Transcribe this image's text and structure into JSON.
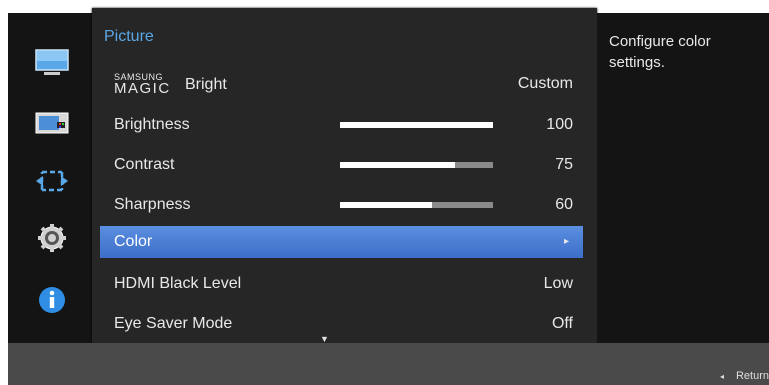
{
  "sidebar": {
    "icons": [
      "picture-icon",
      "onscreen-display-icon",
      "system-icon",
      "settings-icon",
      "information-icon"
    ]
  },
  "menu": {
    "title": "Picture",
    "magic_bright": {
      "brand_small": "SAMSUNG",
      "brand_large": "MAGIC",
      "label": "Bright",
      "value": "Custom"
    },
    "brightness": {
      "label": "Brightness",
      "value": "100",
      "level": 1.0
    },
    "contrast": {
      "label": "Contrast",
      "value": "75",
      "level": 0.75
    },
    "sharpness": {
      "label": "Sharpness",
      "value": "60",
      "level": 0.6
    },
    "color": {
      "label": "Color",
      "arrow": "▸"
    },
    "hdmi_black_level": {
      "label": "HDMI Black Level",
      "value": "Low"
    },
    "eye_saver_mode": {
      "label": "Eye Saver Mode",
      "value": "Off"
    },
    "scroll_down": "▼"
  },
  "description": "Configure color settings.",
  "footer": {
    "return_arrow": "◂",
    "return_label": "Return"
  },
  "colors": {
    "accent": "#5aa7e8",
    "selected": "#4a7fd6",
    "background": "#262626"
  }
}
